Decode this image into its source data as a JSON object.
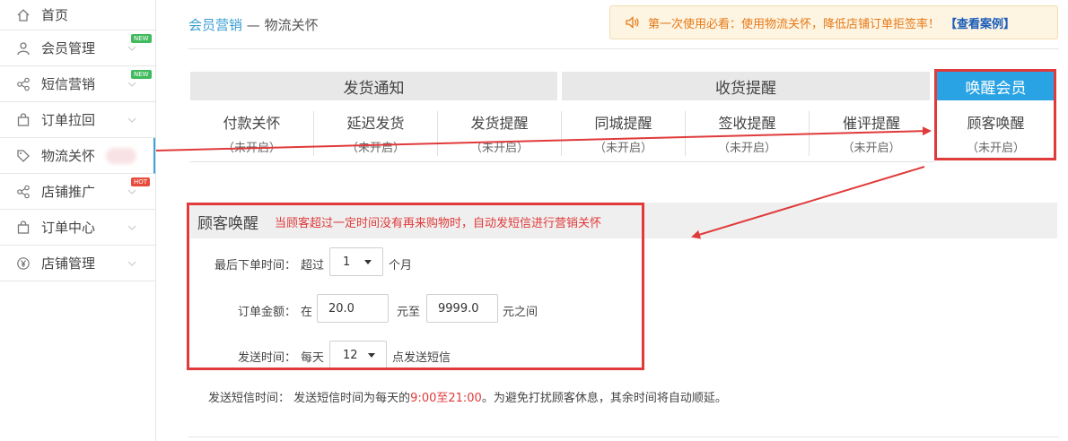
{
  "sidebar": {
    "items": [
      {
        "label": "首页",
        "icon": "home-icon"
      },
      {
        "label": "会员管理",
        "icon": "user-icon",
        "badge": "NEW"
      },
      {
        "label": "短信营销",
        "icon": "share-icon",
        "badge": "NEW"
      },
      {
        "label": "订单拉回",
        "icon": "bag-icon"
      },
      {
        "label": "物流关怀",
        "icon": "tag-icon"
      },
      {
        "label": "店铺推广",
        "icon": "share-icon",
        "badge": "HOT"
      },
      {
        "label": "订单中心",
        "icon": "bag-icon"
      },
      {
        "label": "店铺管理",
        "icon": "yen-icon"
      }
    ]
  },
  "breadcrumb": {
    "parent": "会员营销",
    "separator": " — ",
    "current": "物流关怀"
  },
  "notice": {
    "text": "第一次使用必看：使用物流关怀，降低店铺订单拒签率！",
    "link": "【查看案例】"
  },
  "categories": [
    {
      "label": "发货通知"
    },
    {
      "label": "收货提醒"
    },
    {
      "label": "唤醒会员"
    }
  ],
  "subtabs": [
    {
      "title": "付款关怀",
      "status": "（未开启）"
    },
    {
      "title": "延迟发货",
      "status": "（未开启）"
    },
    {
      "title": "发货提醒",
      "status": "（未开启）"
    },
    {
      "title": "同城提醒",
      "status": "（未开启）"
    },
    {
      "title": "签收提醒",
      "status": "（未开启）"
    },
    {
      "title": "催评提醒",
      "status": "（未开启）"
    },
    {
      "title": "顾客唤醒",
      "status": "（未开启）"
    }
  ],
  "section": {
    "title": "顾客唤醒",
    "desc": "当顾客超过一定时间没有再来购物时，自动发短信进行营销关怀"
  },
  "form": {
    "last_order": {
      "label": "最后下单时间：",
      "prefix": "超过",
      "value": "1",
      "suffix": "个月"
    },
    "amount": {
      "label": "订单金额：",
      "prefix": "在",
      "min": "20.0",
      "mid": "元至",
      "max": "9999.0",
      "suffix": "元之间"
    },
    "send_time": {
      "label": "发送时间：",
      "prefix": "每天",
      "value": "12",
      "suffix": "点发送短信"
    }
  },
  "footer": {
    "label": "发送短信时间：",
    "text1": "发送短信时间为每天的",
    "highlight": "9:00至21:00",
    "text2": "。为避免打扰顾客休息，其余时间将自动顺延。"
  },
  "colors": {
    "accent": "#29a3e4",
    "annotation_red": "#e03a3a",
    "notice_orange": "#e77916"
  }
}
